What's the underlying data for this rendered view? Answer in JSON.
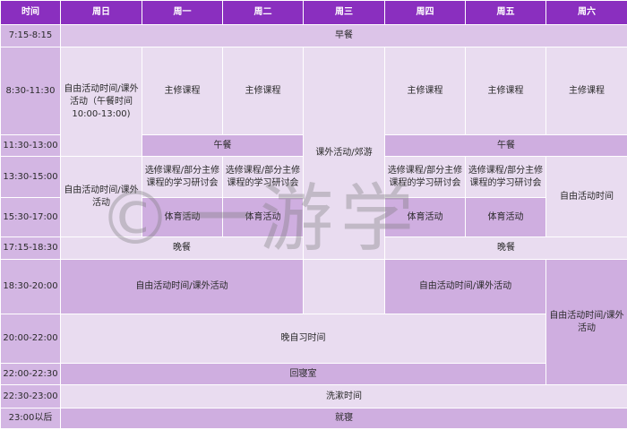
{
  "header": {
    "time": "时间",
    "days": [
      "周日",
      "周一",
      "周二",
      "周三",
      "周四",
      "周五",
      "周六"
    ]
  },
  "times": [
    "7:15-8:15",
    "8:30-11:30",
    "11:30-13:00",
    "13:30-15:00",
    "15:30-17:00",
    "17:15-18:30",
    "18:30-20:00",
    "20:00-22:00",
    "22:00-22:30",
    "22:30-23:00",
    "23:00以后"
  ],
  "cells": {
    "breakfast": "早餐",
    "sun_morning": "自由活动时间/课外活动（午餐时间 10:00-13:00)",
    "core_course": "主修课程",
    "lunch": "午餐",
    "sun_afternoon": "自由活动时间/课外活动",
    "elective": "选修课程/部分主修课程的学习研讨会",
    "wed_excursion": "课外活动/郊游",
    "sat_afternoon": "自由活动时间",
    "sports": "体育活动",
    "dinner": "晚餐",
    "evening_free": "自由活动时间/课外活动",
    "sat_evening": "自由活动时间/课外活动",
    "self_study": "晚自习时间",
    "back_dorm": "回寝室",
    "wash": "洗漱时间",
    "sleep": "就寝"
  },
  "watermark": "©一游学"
}
